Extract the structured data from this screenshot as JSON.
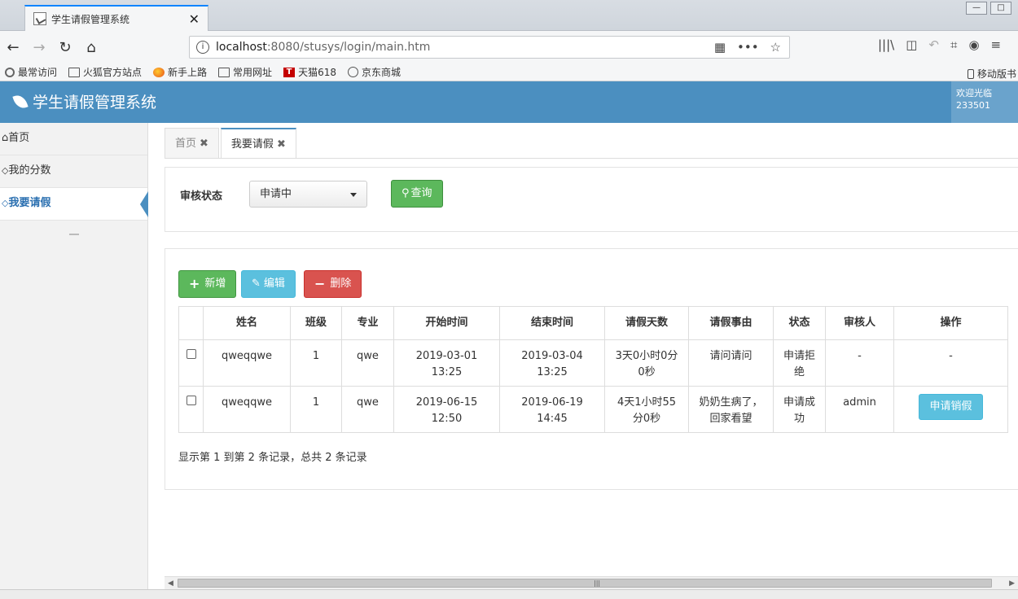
{
  "browser": {
    "tab_title": "学生请假管理系统",
    "tab_close": "✕",
    "url_prefix": "localhost",
    "url_rest": ":8080/stusys/login/main.htm",
    "bookmarks": [
      {
        "label": "最常访问",
        "icon": "gear-icon"
      },
      {
        "label": "火狐官方站点",
        "icon": "folder-icon"
      },
      {
        "label": "新手上路",
        "icon": "firefox-icon"
      },
      {
        "label": "常用网址",
        "icon": "folder-icon"
      },
      {
        "label": "天猫618",
        "icon": "tmall-icon"
      },
      {
        "label": "京东商城",
        "icon": "globe-icon"
      }
    ],
    "mobile_bookmarks": "移动版书"
  },
  "header": {
    "title": "学生请假管理系统",
    "welcome_line1": "欢迎光临",
    "welcome_line2": "233501"
  },
  "sidebar": {
    "items": [
      {
        "label": "首页"
      },
      {
        "label": "我的分数"
      },
      {
        "label": "我要请假"
      }
    ]
  },
  "tabs": [
    {
      "label": "首页"
    },
    {
      "label": "我要请假"
    }
  ],
  "search": {
    "label": "审核状态",
    "selected": "申请中",
    "button": "查询"
  },
  "toolbar": {
    "add": "新增",
    "edit": "编辑",
    "delete": "删除"
  },
  "table": {
    "headers": [
      "姓名",
      "班级",
      "专业",
      "开始时间",
      "结束时间",
      "请假天数",
      "请假事由",
      "状态",
      "审核人",
      "操作"
    ],
    "rows": [
      {
        "name": "qweqqwe",
        "class": "1",
        "major": "qwe",
        "start_date": "2019-03-01",
        "start_time": "13:25",
        "end_date": "2019-03-04",
        "end_time": "13:25",
        "days_1": "3天0小时0分",
        "days_2": "0秒",
        "reason_1": "请问请问",
        "reason_2": "",
        "status_1": "申请拒",
        "status_2": "绝",
        "reviewer": "-",
        "action": "-"
      },
      {
        "name": "qweqqwe",
        "class": "1",
        "major": "qwe",
        "start_date": "2019-06-15",
        "start_time": "12:50",
        "end_date": "2019-06-19",
        "end_time": "14:45",
        "days_1": "4天1小时55",
        "days_2": "分0秒",
        "reason_1": "奶奶生病了，",
        "reason_2": "回家看望",
        "status_1": "申请成",
        "status_2": "功",
        "reviewer": "admin",
        "action": "申请销假"
      }
    ]
  },
  "pagination": {
    "info": "显示第 1 到第 2 条记录，总共 2 条记录"
  }
}
